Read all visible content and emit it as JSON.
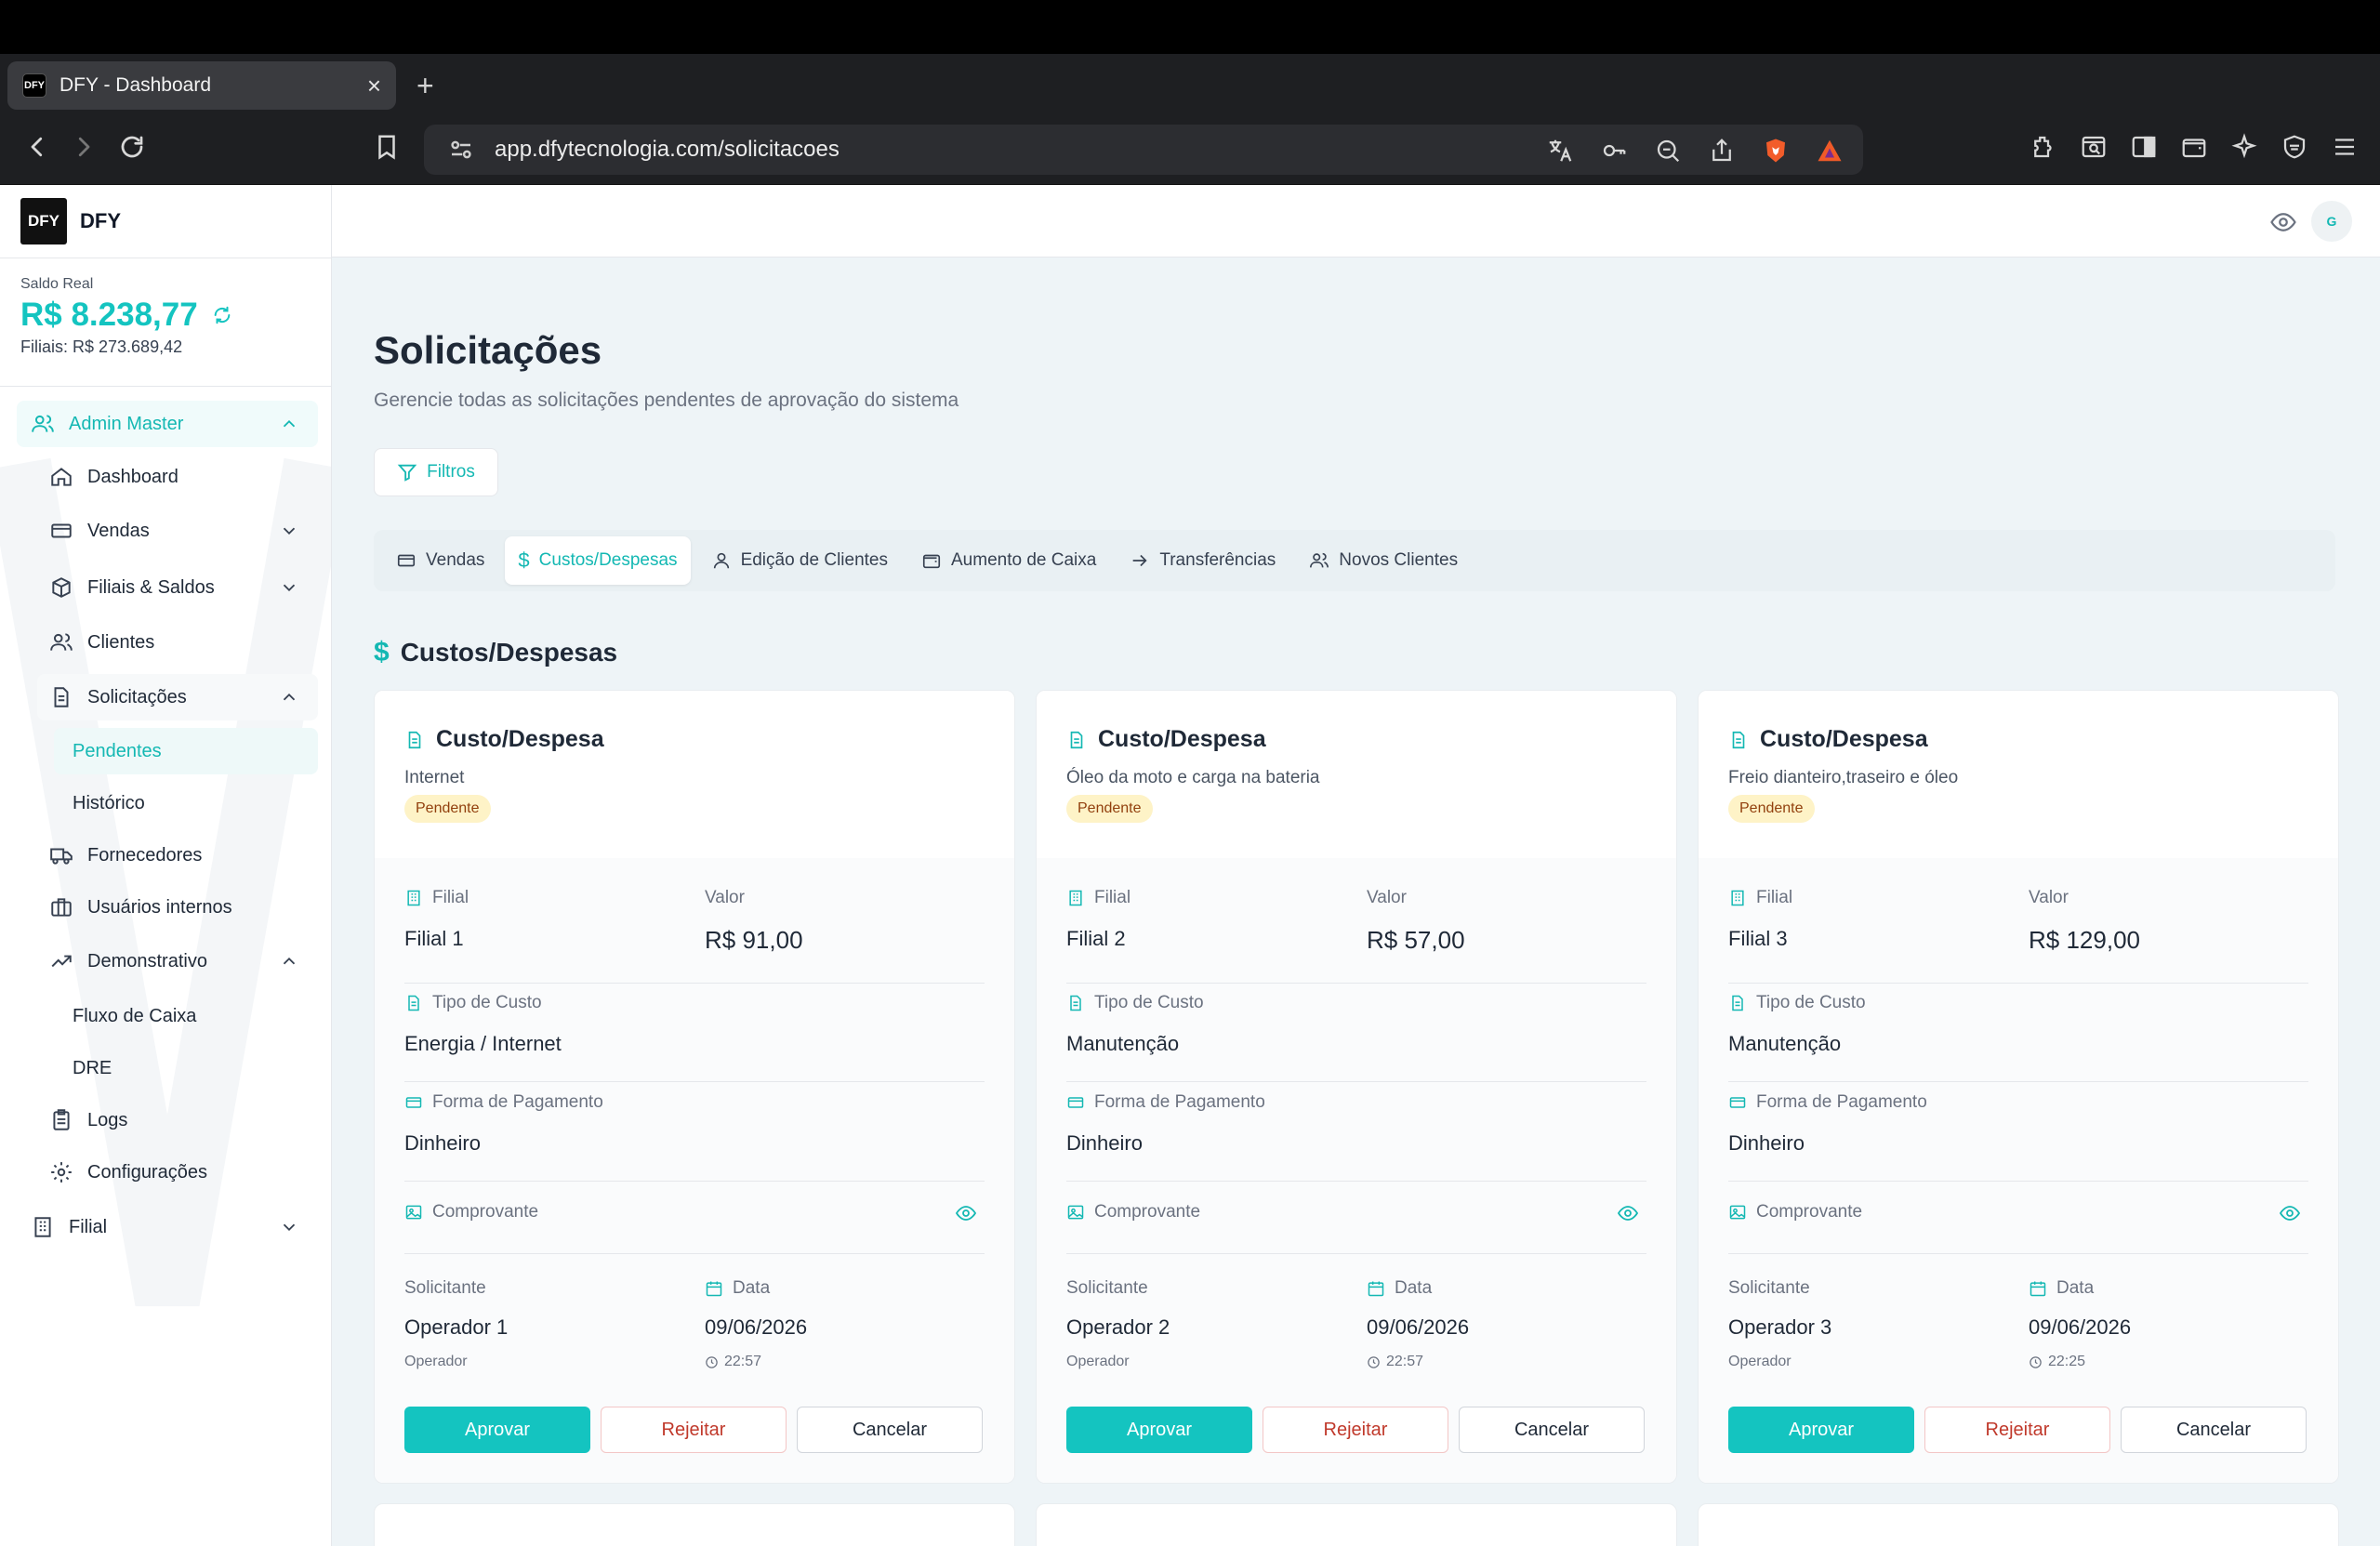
{
  "browser": {
    "tab_title": "DFY - Dashboard",
    "tab_favicon_text": "DFY",
    "new_tab": "+",
    "url": "app.dfytecnologia.com/solicitacoes"
  },
  "sidebar": {
    "brand_logo_text": "DFY",
    "brand_name": "DFY",
    "balance_label": "Saldo Real",
    "balance_value": "R$ 8.238,77",
    "balance_sub": "Filiais: R$ 273.689,42",
    "group_label": "Admin Master",
    "items": [
      {
        "label": "Dashboard",
        "icon": "home-icon"
      },
      {
        "label": "Vendas",
        "icon": "card-icon"
      },
      {
        "label": "Filiais & Saldos",
        "icon": "box-icon"
      },
      {
        "label": "Clientes",
        "icon": "users-icon"
      },
      {
        "label": "Solicitações",
        "icon": "document-icon"
      },
      {
        "label": "Pendentes"
      },
      {
        "label": "Histórico"
      },
      {
        "label": "Fornecedores",
        "icon": "truck-icon"
      },
      {
        "label": "Usuários internos",
        "icon": "briefcase-icon"
      },
      {
        "label": "Demonstrativo",
        "icon": "trend-icon"
      },
      {
        "label": "Fluxo de Caixa"
      },
      {
        "label": "DRE"
      },
      {
        "label": "Logs",
        "icon": "clipboard-icon"
      },
      {
        "label": "Configurações",
        "icon": "gear-icon"
      },
      {
        "label": "Filial",
        "icon": "building-icon"
      }
    ]
  },
  "header": {
    "avatar_initial": "G"
  },
  "main": {
    "title": "Solicitações",
    "subtitle": "Gerencie todas as solicitações pendentes de aprovação do sistema",
    "filter_label": "Filtros",
    "tabs": [
      {
        "label": "Vendas"
      },
      {
        "label": "Custos/Despesas"
      },
      {
        "label": "Edição de Clientes"
      },
      {
        "label": "Aumento de Caixa"
      },
      {
        "label": "Transferências"
      },
      {
        "label": "Novos Clientes"
      }
    ],
    "section_title": "Custos/Despesas",
    "labels": {
      "filial": "Filial",
      "valor": "Valor",
      "tipo_custo": "Tipo de Custo",
      "forma_pagamento": "Forma de Pagamento",
      "comprovante": "Comprovante",
      "solicitante": "Solicitante",
      "data": "Data",
      "aprovar": "Aprovar",
      "rejeitar": "Rejeitar",
      "cancelar": "Cancelar"
    },
    "cards": [
      {
        "title": "Custo/Despesa",
        "description": "Internet",
        "status": "Pendente",
        "filial": "Filial 1",
        "valor": "R$ 91,00",
        "tipo_custo": "Energia / Internet",
        "forma_pagamento": "Dinheiro",
        "solicitante": "Operador 1",
        "solicitante_role": "Operador",
        "data": "09/06/2026",
        "hora": "22:57"
      },
      {
        "title": "Custo/Despesa",
        "description": "Óleo da moto e carga na bateria",
        "status": "Pendente",
        "filial": "Filial 2",
        "valor": "R$ 57,00",
        "tipo_custo": "Manutenção",
        "forma_pagamento": "Dinheiro",
        "solicitante": "Operador 2",
        "solicitante_role": "Operador",
        "data": "09/06/2026",
        "hora": "22:57"
      },
      {
        "title": "Custo/Despesa",
        "description": "Freio dianteiro,traseiro e óleo",
        "status": "Pendente",
        "filial": "Filial 3",
        "valor": "R$ 129,00",
        "tipo_custo": "Manutenção",
        "forma_pagamento": "Dinheiro",
        "solicitante": "Operador 3",
        "solicitante_role": "Operador",
        "data": "09/06/2026",
        "hora": "22:25"
      }
    ]
  },
  "colors": {
    "accent": "#14c4c0",
    "badge_bg": "#fef3c7",
    "reject": "#c0392b"
  }
}
